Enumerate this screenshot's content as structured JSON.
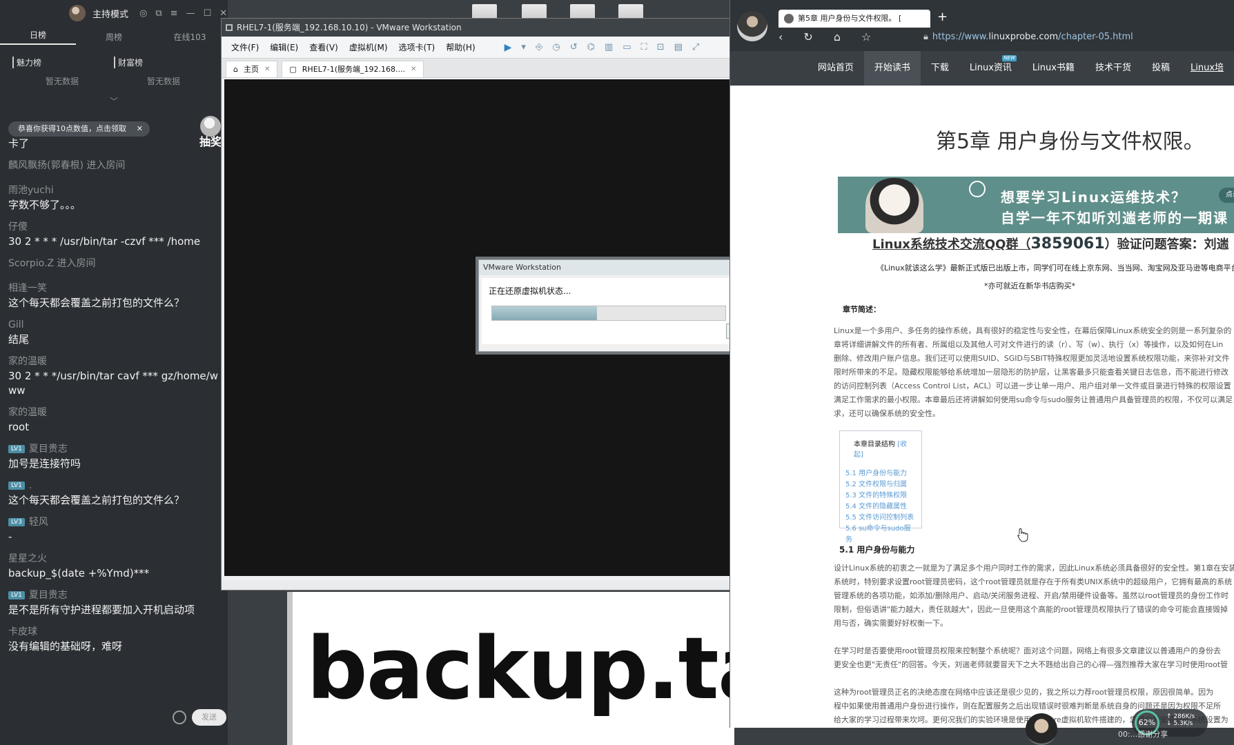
{
  "live_panel": {
    "host_mode": "主持模式",
    "tabs": [
      "日榜",
      "周榜",
      "在线103"
    ],
    "ranks": [
      {
        "title": "魅力榜",
        "empty": "暂无数据"
      },
      {
        "title": "财富榜",
        "empty": "暂无数据"
      }
    ],
    "banner": "恭喜你获得10点数值，点击领取",
    "lottery": "抽奖",
    "chat": [
      {
        "type": "msg",
        "user": "",
        "text": "卡了"
      },
      {
        "type": "enter",
        "text": "麟风飘扬(郭春根) 进入房间"
      },
      {
        "type": "msg",
        "user": "雨池yuchi",
        "text": "字数不够了。。。"
      },
      {
        "type": "msg",
        "user": "仔傻",
        "text": "30 2 * * * /usr/bin/tar -czvf  *** /home"
      },
      {
        "type": "enter",
        "text": "Scorpio.Z 进入房间"
      },
      {
        "type": "msg",
        "user": "相逢一笑",
        "text": "这个每天都会覆盖之前打包的文件么？"
      },
      {
        "type": "msg",
        "user": "Gill",
        "text": "结尾"
      },
      {
        "type": "msg",
        "user": "家的温暖",
        "text": "30 2 * * */usr/bin/tar cavf *** gz/home/www"
      },
      {
        "type": "msg",
        "user": "家的温暖",
        "text": "root"
      },
      {
        "type": "msg",
        "user": "夏目贵志",
        "badge": "LV1",
        "text": "加号是连接符吗"
      },
      {
        "type": "msg",
        "user": ".",
        "badge": "LV1",
        "text": "这个每天都会覆盖之前打包的文件么？"
      },
      {
        "type": "msg",
        "user": "轻风",
        "badge": "LV3",
        "text": "-"
      },
      {
        "type": "msg",
        "user": "星星之火",
        "text": "backup_$(date +%Ymd)***"
      },
      {
        "type": "msg",
        "user": "夏目贵志",
        "badge": "LV1",
        "text": "是不是所有守护进程都要加入开机启动项"
      },
      {
        "type": "msg",
        "user": "卡皮球",
        "text": "没有编辑的基础呀，难呀"
      }
    ],
    "send_label": "发送"
  },
  "vmware": {
    "title": "RHEL7-1(服务端_192.168.10.10) - VMware Workstation",
    "menu": [
      "文件(F)",
      "编辑(E)",
      "查看(V)",
      "虚拟机(M)",
      "选项卡(T)",
      "帮助(H)"
    ],
    "tabs": [
      {
        "label": "主页"
      },
      {
        "label": "RHEL7-1(服务端_192.168...."
      }
    ],
    "dialog": {
      "title": "VMware Workstation",
      "message": "正在还原虚拟机状态...",
      "progress": 0.45
    }
  },
  "slide_text": "backup.tar.g",
  "browser": {
    "tab_title": "第5章 用户身份与文件权限。 [",
    "url_prefix": "https://www.",
    "url_host": "linuxprobe.com",
    "url_path": "/chapter-05.html",
    "site_nav": [
      "网站首页",
      "开始读书",
      "下载",
      "Linux资讯",
      "Linux书籍",
      "技术干货",
      "投稿",
      "Linux培"
    ],
    "site_nav_new_badge": "NEW",
    "page_title": "第5章 用户身份与文件权限。",
    "ad_line1": "想要学习Linux运维技术？",
    "ad_line2": "自学一年不如听刘遄老师的一期课",
    "ad_button": "点击",
    "qq_prefix": "Linux系统技术交流QQ群（",
    "qq_number": "3859061",
    "qq_suffix": "）验证问题答案：刘遄",
    "notice": "《Linux就该这么学》最新正式版已出版上市，同学们可在线上京东网、当当网、淘宝网及亚马逊等电商平台",
    "notice2": "*亦可就近在新华书店购买*",
    "summary_heading": "章节简述：",
    "summary_lines": [
      "Linux是一个多用户、多任务的操作系统，具有很好的稳定性与安全性，在幕后保障Linux系统安全的则是一系列复杂的",
      "章将详细讲解文件的所有者、所属组以及其他人可对文件进行的读（r）、写（w）、执行（x）等操作，以及如何在Lin",
      "删除、修改用户账户信息。我们还可以使用SUID、SGID与SBIT特殊权限更加灵活地设置系统权限功能，来弥补对文件",
      "限时所带来的不足。隐藏权限能够给系统增加一层隐形的防护层，让黑客最多只能查看关键日志信息，而不能进行修改",
      "的访问控制列表（Access Control List，ACL）可以进一步让单一用户、用户组对单一文件或目录进行特殊的权限设置",
      "满足工作需求的最小权限。本章最后还将讲解如何使用su命令与sudo服务让普通用户具备管理员的权限，不仅可以满足",
      "求，还可以确保系统的安全性。"
    ],
    "toc_title": "本章目录结构",
    "toc_toggle": "[收起]",
    "toc_items": [
      "5.1 用户身份与能力",
      "5.2 文件权限与归属",
      "5.3 文件的特殊权限",
      "5.4 文件的隐藏属性",
      "5.5 文件访问控制列表",
      "5.6 su命令与sudo服务"
    ],
    "section_heading": "5.1 用户身份与能力",
    "section_lines": [
      "设计Linux系统的初衷之一就是为了满足多个用户同时工作的需求，因此Linux系统必须具备很好的安全性。第1章在安装",
      "系统时，特别要求设置root管理员密码，这个root管理员就是存在于所有类UNIX系统中的超级用户，它拥有最高的系统",
      "管理系统的各项功能，如添加/删除用户、启动/关闭服务进程、开启/禁用硬件设备等。虽然以root管理员的身份工作时",
      "限制，但俗语讲\"能力越大，责任就越大\"，因此一旦使用这个高能的root管理员权限执行了错误的命令可能会直接毁掉",
      "用与否，确实需要好好权衡一下。",
      "",
      "在学习时是否要使用root管理员权限来控制整个系统呢？面对这个问题，网络上有很多文章建议以普通用户的身份去",
      "更安全也更\"无责任\"的回答。今天，刘遄老师就要冒天下之大不韪给出自己的心得—强烈推荐大家在学习时使用root管",
      "",
      "这种为root管理员正名的决绝态度在网络中应该还是很少见的，我之所以力荐root管理员权限，原因很简单。因为",
      "程中如果使用普通用户身份进行操作，则在配置服务之后出现错误时很难判断是系统自身的问题还是因为权限不足所",
      "给大家的学习过程带来坎坷。更何况我们的实验环境是使用VMware虚拟机软件搭建的，您可以将安装好的系统设置为"
    ],
    "net": {
      "cpu": "62%",
      "up": "286K/s",
      "down": "5.3K/s"
    },
    "bottom_text": "00:...感谢分享"
  }
}
